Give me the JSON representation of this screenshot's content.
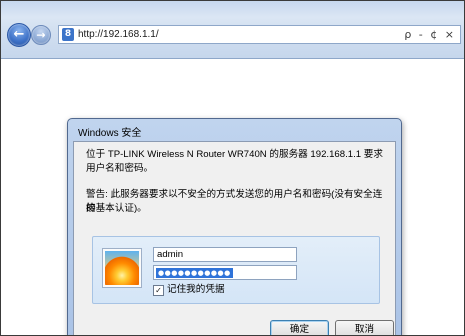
{
  "browser": {
    "url": "http://192.168.1.1/",
    "address_actions": "ρ - ¢ ×",
    "page_icon_glyph": "8"
  },
  "dialog": {
    "title": "Windows 安全",
    "message_line1": "位于 TP-LINK Wireless N Router WR740N 的服务器 192.168.1.1 要求",
    "message_line2": "用户名和密码。",
    "warning_line1": "警告: 此服务器要求以不安全的方式发送您的用户名和密码(没有安全连接",
    "warning_line2": "的基本认证)。",
    "username_value": "admin",
    "password_value": "●●●●●●●●●●●",
    "remember_label": "记住我的凭据",
    "remember_checked": true,
    "ok_label": "确定",
    "cancel_label": "取消"
  }
}
